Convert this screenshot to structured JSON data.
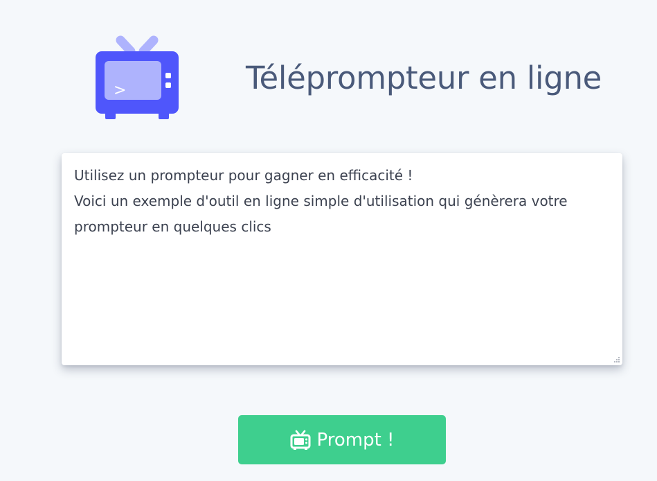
{
  "header": {
    "title": "Téléprompteur en ligne",
    "logo_icon": "tv-terminal-icon",
    "logo_glyph": ">"
  },
  "editor": {
    "text": "Utilisez un prompteur pour gagner en efficacité !\nVoici un exemple d'outil en ligne simple d'utilisation qui génèrera votre prompteur en quelques clics"
  },
  "prompt_button": {
    "label": "Prompt !",
    "icon": "tv-icon"
  },
  "colors": {
    "background": "#f5f8fb",
    "logo_primary": "#4f56fb",
    "logo_light": "#aeb3fd",
    "title_text": "#4a5a7a",
    "button_bg": "#3ecf8e"
  }
}
